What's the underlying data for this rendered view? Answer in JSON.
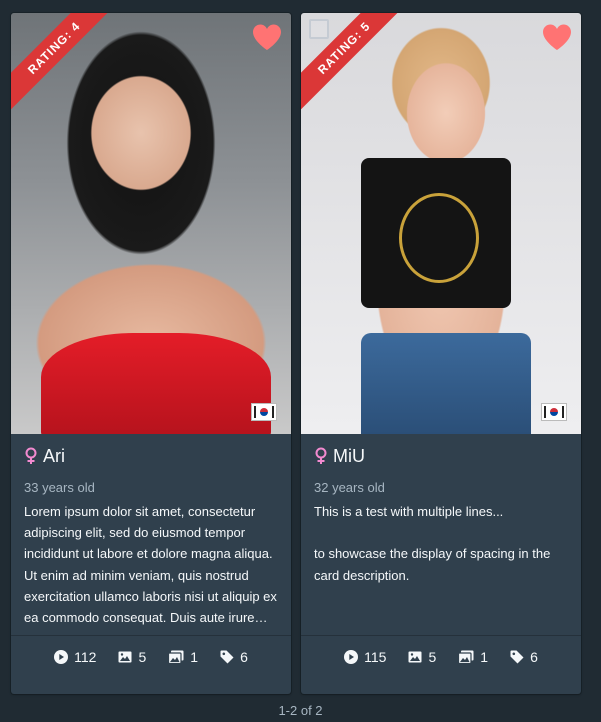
{
  "cards": [
    {
      "rating_label": "RATING: 4",
      "name": "Ari",
      "age": "33 years old",
      "description": "Lorem ipsum dolor sit amet, consectetur adipiscing elit, sed do eiusmod tempor incididunt ut labore et dolore magna aliqua. Ut enim ad minim veniam, quis nostrud exercitation ullamco laboris nisi ut aliquip ex ea commodo consequat. Duis aute irure dolor in reprehenderit in voluptate velit esse cillum dolore eu fugiat nulla pariatur.",
      "stats": {
        "plays": "112",
        "images": "5",
        "galleries": "1",
        "tags": "6"
      },
      "favorite": true,
      "checkbox_visible": false
    },
    {
      "rating_label": "RATING: 5",
      "name": "MiU",
      "age": "32 years old",
      "description": "This is a test with multiple lines...\n\nto showcase the display of spacing in the card description.",
      "stats": {
        "plays": "115",
        "images": "5",
        "galleries": "1",
        "tags": "6"
      },
      "favorite": true,
      "checkbox_visible": true
    }
  ],
  "pagination": {
    "label": "1-2 of 2"
  },
  "colors": {
    "ribbon": "#db3737",
    "heart": "#ff7373",
    "gender_female": "#f28ad0",
    "background": "#202b33",
    "card": "#30404d"
  }
}
